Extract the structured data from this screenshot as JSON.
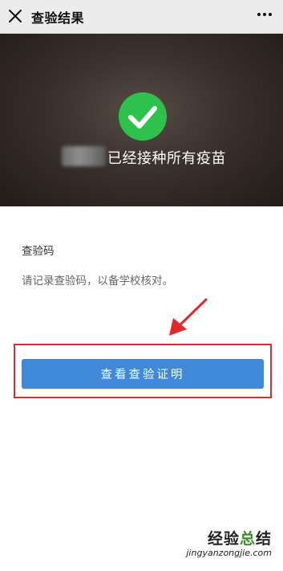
{
  "header": {
    "title": "查验结果",
    "close_icon": "close-icon",
    "more_icon": "more-icon"
  },
  "hero": {
    "status_text": "已经接种所有疫苗",
    "status_icon": "checkmark-circle-icon",
    "status_color": "#2ec24d"
  },
  "section": {
    "label": "查验码",
    "description": "请记录查验码，以备学校核对。"
  },
  "action": {
    "button_label": "查看查验证明",
    "button_color": "#3f89d8",
    "highlight_color": "#e0282e"
  },
  "watermark": {
    "main_prefix": "经验",
    "main_accent": "总",
    "main_suffix": "结",
    "sub": "jingyanzongjie.com"
  }
}
